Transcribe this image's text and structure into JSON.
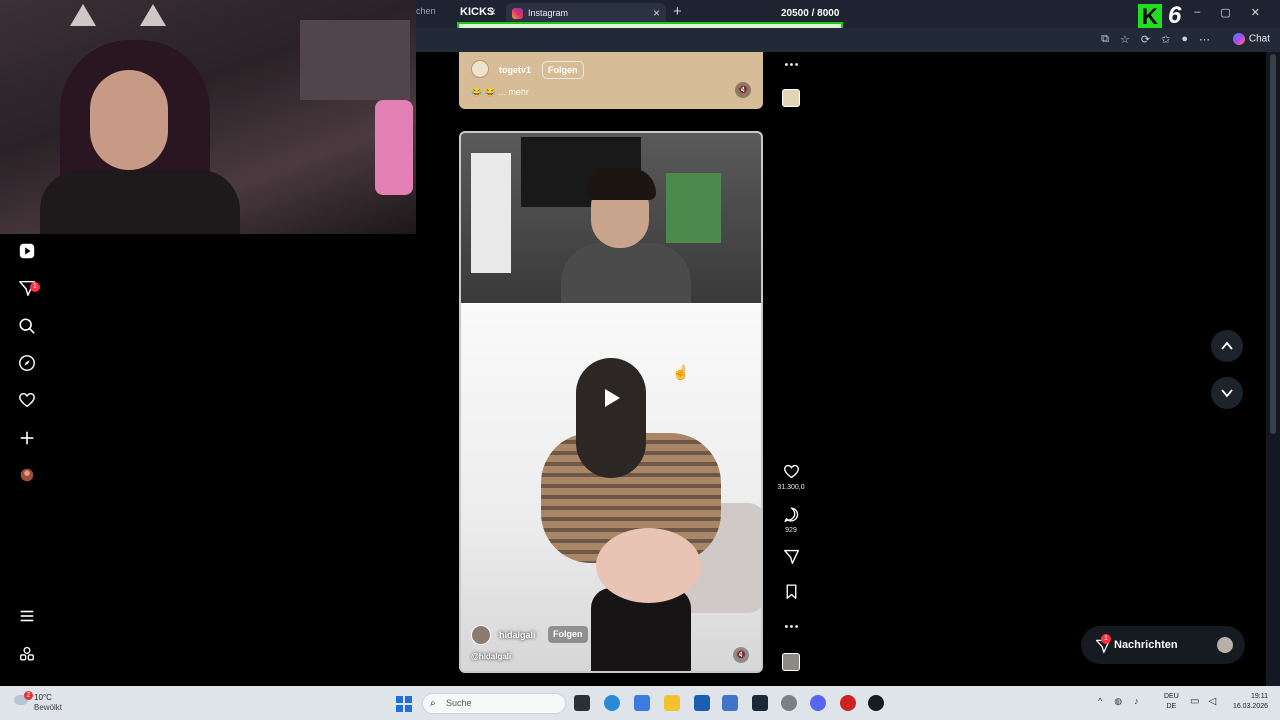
{
  "browser": {
    "prev_tab_fragment": "chen",
    "kicks_label": "KICKS",
    "active_tab_title": "Instagram",
    "goal_text": "20500  / 8000",
    "goal_progress": 1.0,
    "kick_count": "6",
    "chat_label": "Chat"
  },
  "feed": {
    "post1": {
      "username": "togetv1",
      "follow_label": "Folgen",
      "caption": "😂 😂 ... mehr"
    },
    "post2": {
      "username": "hidalgali",
      "follow_label": "Folgen",
      "handle": "@hidalgali",
      "likes": "31.300,0",
      "comments": "929"
    }
  },
  "leftnav": {
    "notification_badge": "1"
  },
  "messages": {
    "label": "Nachrichten",
    "badge": "1"
  },
  "taskbar": {
    "weather_temp": "10°C",
    "weather_cond": "Bewölkt",
    "weather_badge": "2",
    "search_placeholder": "Suche",
    "lang_1": "DEU",
    "lang_2": "DE",
    "time": "19:11",
    "date": "16.03.2026"
  }
}
